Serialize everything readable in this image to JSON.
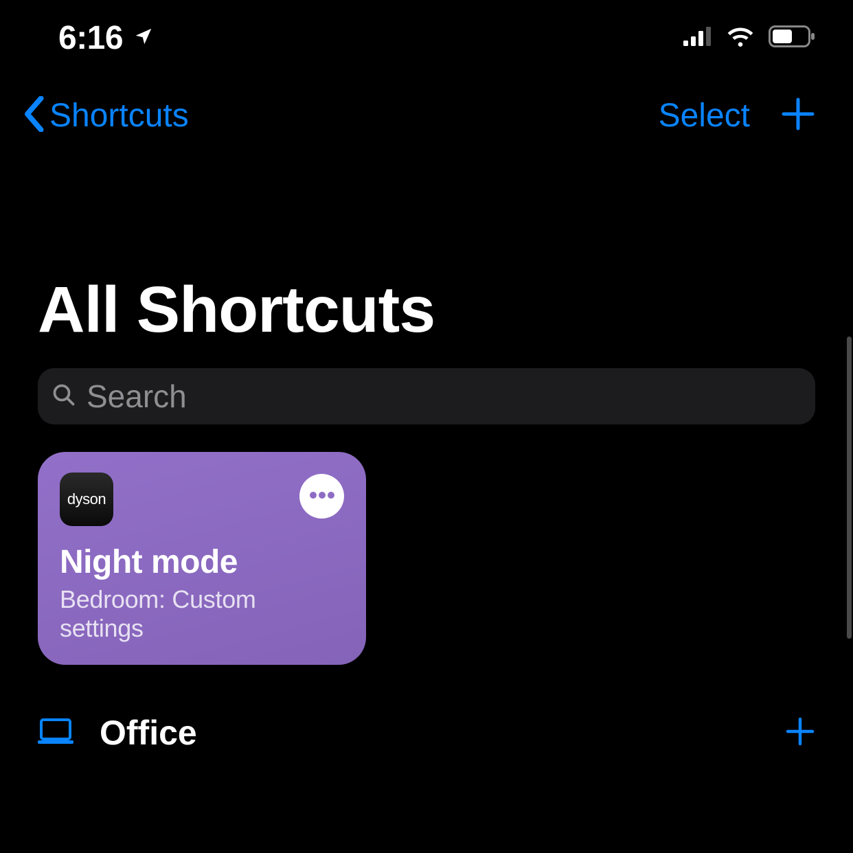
{
  "status": {
    "time": "6:16"
  },
  "nav": {
    "back_label": "Shortcuts",
    "select_label": "Select"
  },
  "page": {
    "title": "All Shortcuts"
  },
  "search": {
    "placeholder": "Search"
  },
  "cards": [
    {
      "app_icon_label": "dyson",
      "title": "Night mode",
      "subtitle": "Bedroom: Custom settings",
      "color": "#8f6cc4"
    }
  ],
  "sections": [
    {
      "icon": "laptop-icon",
      "title": "Office"
    }
  ],
  "colors": {
    "accent": "#0a84ff",
    "background": "#000000",
    "search_bg": "#1c1c1e"
  }
}
